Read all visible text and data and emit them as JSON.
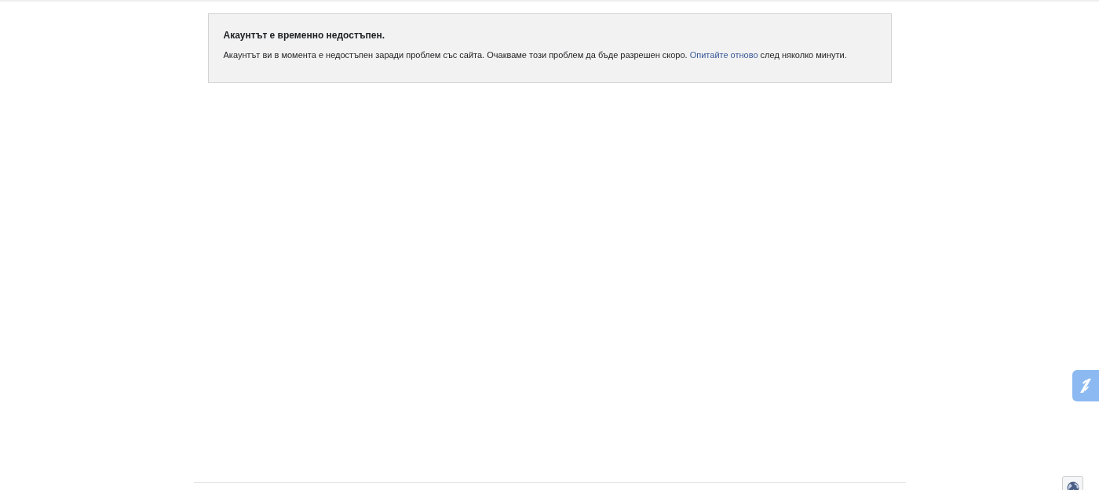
{
  "notice": {
    "title": "Акаунтът е временно недостъпен.",
    "body": {
      "text_before": "Акаунтът ви в момента е недостъпен заради проблем със сайта. Очакваме този проблем да бъде разрешен скоро. ",
      "link": "Опитайте отново",
      "text_after": " след няколко минути."
    }
  }
}
